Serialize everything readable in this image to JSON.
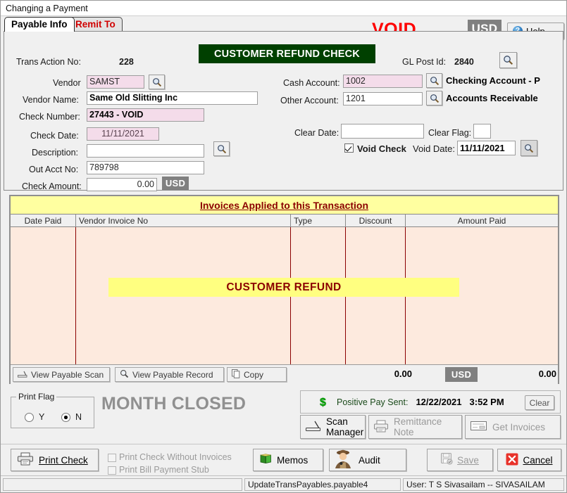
{
  "window": {
    "title": "Changing a Payment"
  },
  "tabs": [
    {
      "label": "Payable Info",
      "active": true
    },
    {
      "label": "Remit To",
      "active": false
    }
  ],
  "header": {
    "void_word": "VOID",
    "currency_badge": "USD",
    "help_label": "Help",
    "help_icon": "question-circle-icon"
  },
  "form": {
    "trans_action_label": "Trans Action No:",
    "trans_action_value": "228",
    "vendor_label": "Vendor",
    "vendor_value": "SAMST",
    "vendor_name_label": "Vendor Name:",
    "vendor_name_value": "Same Old Slitting Inc",
    "check_number_label": "Check Number:",
    "check_number_value": "27443 - VOID",
    "check_date_label": "Check Date:",
    "check_date_value": "11/11/2021",
    "description_label": "Description:",
    "description_value": "",
    "out_acct_label": "Out Acct No:",
    "out_acct_value": "789798",
    "check_amount_label": "Check Amount:",
    "check_amount_value": "0.00",
    "check_amount_currency": "USD",
    "banner": "CUSTOMER REFUND CHECK",
    "gl_post_label": "GL Post Id:",
    "gl_post_value": "2840",
    "cash_account_label": "Cash Account:",
    "cash_account_value": "1002",
    "cash_account_name": "Checking Account - P",
    "other_account_label": "Other Account:",
    "other_account_value": "1201",
    "other_account_name": "Accounts Receivable",
    "clear_date_label": "Clear Date:",
    "clear_date_value": "",
    "clear_flag_label": "Clear Flag:",
    "clear_flag_value": "",
    "void_check_label": "Void Check",
    "void_check_checked": true,
    "void_date_label": "Void Date:",
    "void_date_value": "11/11/2021"
  },
  "grid": {
    "title": "Invoices Applied to this Transaction",
    "columns": [
      "Date Paid",
      "Vendor Invoice No",
      "Type",
      "Discount",
      "Amount Paid"
    ],
    "rows": [],
    "overlay_text": "CUSTOMER REFUND",
    "footer": {
      "view_payable_scan": "View Payable Scan",
      "view_payable_record": "View Payable Record",
      "copy": "Copy",
      "discount_total": "0.00",
      "currency": "USD",
      "amount_total": "0.00"
    }
  },
  "print_flag": {
    "legend": "Print Flag",
    "option_y": "Y",
    "option_n": "N",
    "selected": "N"
  },
  "month_closed": "MONTH CLOSED",
  "positive_pay": {
    "icon": "dollar-icon",
    "label": "Positive Pay Sent:",
    "date": "12/22/2021",
    "time": "3:52 PM",
    "clear_label": "Clear"
  },
  "action_buttons": {
    "scan_manager_line1": "Scan",
    "scan_manager_line2": "Manager",
    "remittance_line1": "Remittance",
    "remittance_line2": "Note",
    "get_invoices": "Get Invoices"
  },
  "bottom": {
    "print_check": "Print Check",
    "print_check_without_invoices": "Print Check Without Invoices",
    "print_bill_payment_stub": "Print Bill Payment Stub",
    "memos": "Memos",
    "audit": "Audit",
    "save": "Save",
    "cancel": "Cancel"
  },
  "status_bar": {
    "left": "",
    "middle": "UpdateTransPayables.payable4",
    "right": "User: T S Sivasailam -- SIVASAILAM"
  },
  "colors": {
    "void_red": "#fe0000",
    "banner_green": "#004000",
    "grid_title_yellow": "#ffffa0",
    "refund_yellow": "#ffff80",
    "dark_red": "#8b0000",
    "pink_field": "#f4dcea",
    "peach_body": "#fdeade",
    "usd_gray": "#808080",
    "month_closed_gray": "#909090"
  }
}
